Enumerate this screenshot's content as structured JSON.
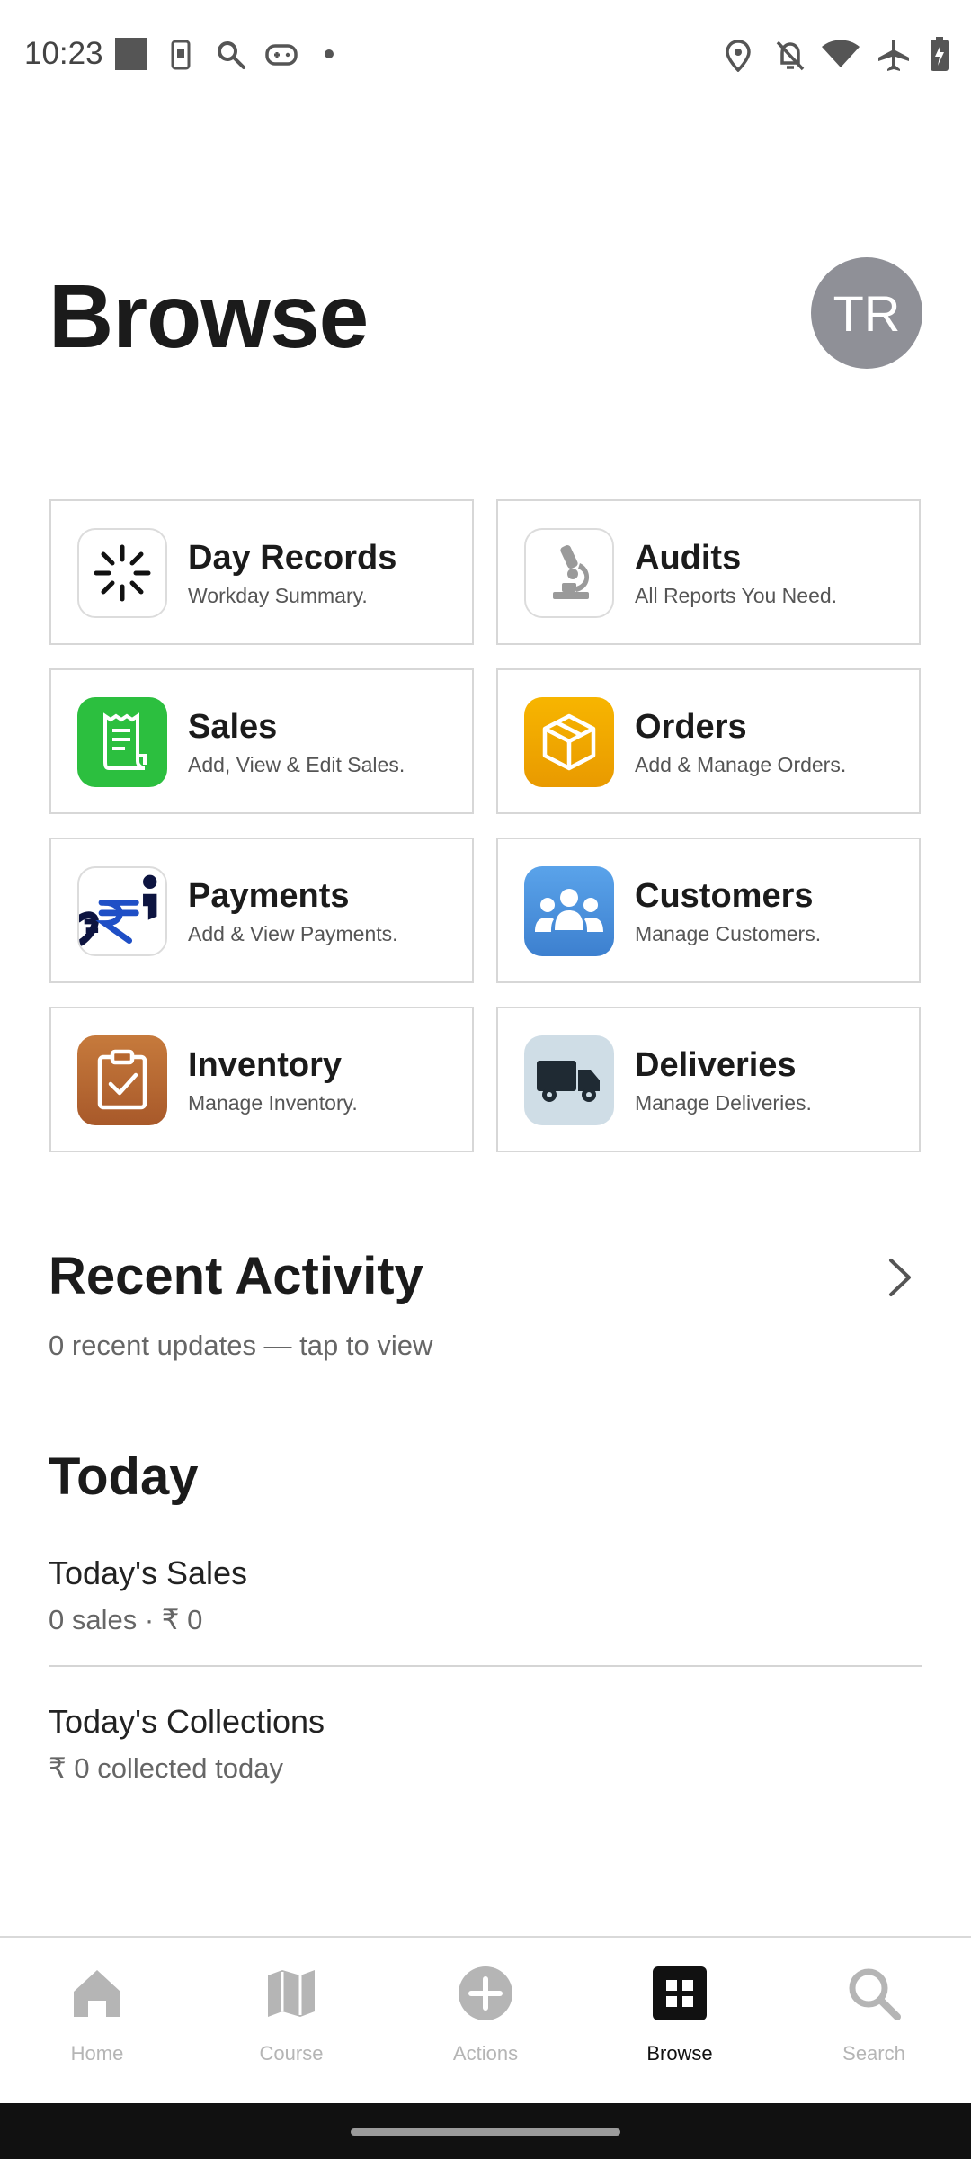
{
  "status_bar": {
    "time": "10:23",
    "left_icons": [
      "square-icon",
      "phone-icon",
      "search-icon",
      "gamepad-icon",
      "dot-icon"
    ],
    "right_icons": [
      "location-icon",
      "bell-off-icon",
      "wifi-icon",
      "airplane-icon",
      "battery-charging-icon"
    ]
  },
  "header": {
    "title": "Browse",
    "avatar_initials": "TR"
  },
  "cards": [
    {
      "title": "Day Records",
      "subtitle": "Workday Summary.",
      "icon": "loading-spinner-icon"
    },
    {
      "title": "Audits",
      "subtitle": "All Reports You Need.",
      "icon": "microscope-icon"
    },
    {
      "title": "Sales",
      "subtitle": "Add, View & Edit Sales.",
      "icon": "receipt-icon",
      "color": "#2cbf3f"
    },
    {
      "title": "Orders",
      "subtitle": "Add & Manage Orders.",
      "icon": "box-icon",
      "color": "#f2a400"
    },
    {
      "title": "Payments",
      "subtitle": "Add & View Payments.",
      "icon": "rupee-payment-icon"
    },
    {
      "title": "Customers",
      "subtitle": "Manage Customers.",
      "icon": "people-icon",
      "color": "#4a90d9"
    },
    {
      "title": "Inventory",
      "subtitle": "Manage Inventory.",
      "icon": "clipboard-check-icon",
      "color": "#b8672e"
    },
    {
      "title": "Deliveries",
      "subtitle": "Manage Deliveries.",
      "icon": "truck-icon",
      "color": "#cfdde6"
    }
  ],
  "recent_activity": {
    "title": "Recent Activity",
    "subtitle": "0 recent updates — tap to view"
  },
  "today": {
    "title": "Today",
    "items": [
      {
        "title": "Today's Sales",
        "subtitle": "0 sales · ₹ 0"
      },
      {
        "title": "Today's Collections",
        "subtitle": "₹ 0 collected today"
      }
    ]
  },
  "bottom_nav": {
    "items": [
      {
        "label": "Home",
        "icon": "home-icon"
      },
      {
        "label": "Course",
        "icon": "map-icon"
      },
      {
        "label": "Actions",
        "icon": "plus-circle-icon"
      },
      {
        "label": "Browse",
        "icon": "grid-icon",
        "active": true
      },
      {
        "label": "Search",
        "icon": "search-icon"
      }
    ]
  }
}
